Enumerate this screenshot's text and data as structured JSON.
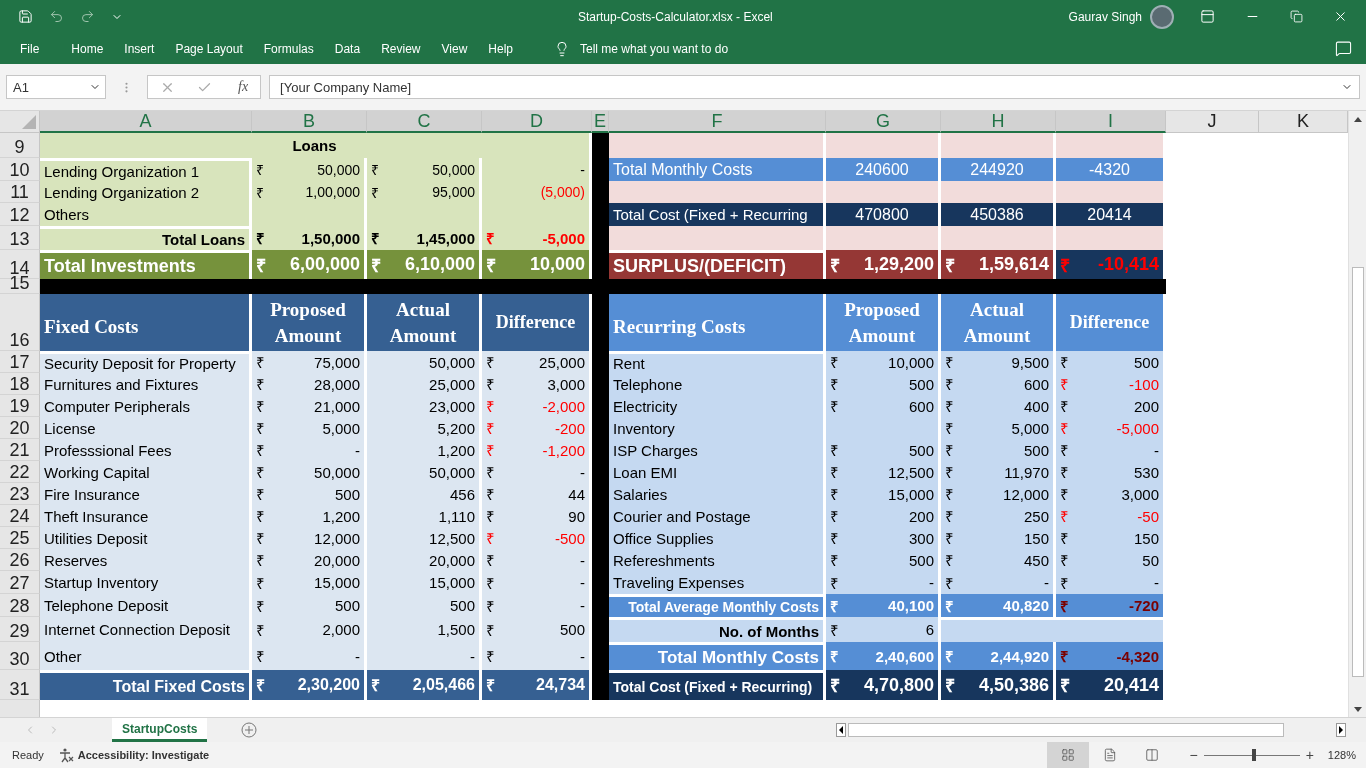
{
  "window": {
    "title": "Startup-Costs-Calculator.xlsx - Excel",
    "user": "Gaurav Singh"
  },
  "ribbon": {
    "tabs": [
      "File",
      "Home",
      "Insert",
      "Page Layout",
      "Formulas",
      "Data",
      "Review",
      "View",
      "Help"
    ],
    "tell_me": "Tell me what you want to do"
  },
  "formula_bar": {
    "name_box": "A1",
    "fx": "fx",
    "value": "[Your Company Name]"
  },
  "columns": [
    {
      "label": "A",
      "selected": true
    },
    {
      "label": "B",
      "selected": true
    },
    {
      "label": "C",
      "selected": true
    },
    {
      "label": "D",
      "selected": true
    },
    {
      "label": "E",
      "selected": true
    },
    {
      "label": "F",
      "selected": true
    },
    {
      "label": "G",
      "selected": true
    },
    {
      "label": "H",
      "selected": true
    },
    {
      "label": "I",
      "selected": true
    },
    {
      "label": "J",
      "selected": false
    },
    {
      "label": "K",
      "selected": false
    }
  ],
  "row_numbers": [
    "9",
    "10",
    "11",
    "12",
    "13",
    "14",
    "15",
    "16",
    "17",
    "18",
    "19",
    "20",
    "21",
    "22",
    "23",
    "24",
    "25",
    "26",
    "27",
    "28",
    "29",
    "30",
    "31"
  ],
  "loans": {
    "title": "Loans",
    "rows": [
      {
        "label": "Lending Organization 1",
        "proposed": {
          "symbol": "₹",
          "value": "50,000"
        },
        "actual": {
          "symbol": "₹",
          "value": "50,000"
        },
        "difference": {
          "value": "-",
          "negative": false
        }
      },
      {
        "label": "Lending Organization 2",
        "proposed": {
          "symbol": "₹",
          "value": "1,00,000"
        },
        "actual": {
          "symbol": "₹",
          "value": "95,000"
        },
        "difference": {
          "value": "(5,000)",
          "negative": true
        }
      },
      {
        "label": "Others",
        "proposed": {},
        "actual": {},
        "difference": {}
      }
    ],
    "total": {
      "label": "Total Loans",
      "proposed": {
        "symbol": "₹",
        "value": "1,50,000"
      },
      "actual": {
        "symbol": "₹",
        "value": "1,45,000"
      },
      "difference": {
        "symbol": "₹",
        "value": "-5,000",
        "negative": true
      }
    }
  },
  "total_investments": {
    "label": "Total Investments",
    "proposed": {
      "symbol": "₹",
      "value": "6,00,000"
    },
    "actual": {
      "symbol": "₹",
      "value": "6,10,000"
    },
    "difference": {
      "symbol": "₹",
      "value": "10,000",
      "negative": false
    }
  },
  "summary": {
    "rows": [
      {
        "kind": "blank"
      },
      {
        "kind": "monthly",
        "label": "Total Monthly Costs",
        "proposed": {
          "value": "240600"
        },
        "actual": {
          "value": "244920"
        },
        "difference": {
          "value": "-4320",
          "negative": false
        }
      },
      {
        "kind": "blank"
      },
      {
        "kind": "total",
        "label": "Total Cost (Fixed + Recurring",
        "proposed": {
          "value": "470800"
        },
        "actual": {
          "value": "450386"
        },
        "difference": {
          "value": "20414",
          "negative": false
        }
      },
      {
        "kind": "blank"
      }
    ],
    "surplus": {
      "label": "SURPLUS/(DEFICIT)",
      "proposed": {
        "symbol": "₹",
        "value": "1,29,200"
      },
      "actual": {
        "symbol": "₹",
        "value": "1,59,614"
      },
      "difference": {
        "symbol": "₹",
        "value": "-10,414",
        "negative": true
      }
    }
  },
  "fixed_costs": {
    "title": "Fixed Costs",
    "columns": [
      "Proposed Amount",
      "Actual Amount",
      "Difference"
    ],
    "rows": [
      {
        "label": "Security Deposit for Property",
        "proposed": {
          "symbol": "₹",
          "value": "75,000"
        },
        "actual": {
          "value": "50,000"
        },
        "difference": {
          "symbol": "₹",
          "value": "25,000",
          "negative": false
        }
      },
      {
        "label": "Furnitures and Fixtures",
        "proposed": {
          "symbol": "₹",
          "value": "28,000"
        },
        "actual": {
          "value": "25,000"
        },
        "difference": {
          "symbol": "₹",
          "value": "3,000",
          "negative": false
        }
      },
      {
        "label": "Computer Peripherals",
        "proposed": {
          "symbol": "₹",
          "value": "21,000"
        },
        "actual": {
          "value": "23,000"
        },
        "difference": {
          "symbol": "₹",
          "value": "-2,000",
          "negative": true
        }
      },
      {
        "label": "License",
        "proposed": {
          "symbol": "₹",
          "value": "5,000"
        },
        "actual": {
          "value": "5,200"
        },
        "difference": {
          "symbol": "₹",
          "value": "-200",
          "negative": true
        }
      },
      {
        "label": "Professsional Fees",
        "proposed": {
          "symbol": "₹",
          "value": "-"
        },
        "actual": {
          "value": "1,200"
        },
        "difference": {
          "symbol": "₹",
          "value": "-1,200",
          "negative": true
        }
      },
      {
        "label": "Working Capital",
        "proposed": {
          "symbol": "₹",
          "value": "50,000"
        },
        "actual": {
          "value": "50,000"
        },
        "difference": {
          "symbol": "₹",
          "value": "-",
          "negative": false
        }
      },
      {
        "label": "Fire Insurance",
        "proposed": {
          "symbol": "₹",
          "value": "500"
        },
        "actual": {
          "value": "456"
        },
        "difference": {
          "symbol": "₹",
          "value": "44",
          "negative": false
        }
      },
      {
        "label": "Theft Insurance",
        "proposed": {
          "symbol": "₹",
          "value": "1,200"
        },
        "actual": {
          "value": "1,110"
        },
        "difference": {
          "symbol": "₹",
          "value": "90",
          "negative": false
        }
      },
      {
        "label": "Utilities Deposit",
        "proposed": {
          "symbol": "₹",
          "value": "12,000"
        },
        "actual": {
          "value": "12,500"
        },
        "difference": {
          "symbol": "₹",
          "value": "-500",
          "negative": true
        }
      },
      {
        "label": "Reserves",
        "proposed": {
          "symbol": "₹",
          "value": "20,000"
        },
        "actual": {
          "value": "20,000"
        },
        "difference": {
          "symbol": "₹",
          "value": "-",
          "negative": false
        }
      },
      {
        "label": "Startup Inventory",
        "proposed": {
          "symbol": "₹",
          "value": "15,000"
        },
        "actual": {
          "value": "15,000"
        },
        "difference": {
          "symbol": "₹",
          "value": "-",
          "negative": false
        }
      },
      {
        "label": "Telephone Deposit",
        "proposed": {
          "symbol": "₹",
          "value": "500"
        },
        "actual": {
          "value": "500"
        },
        "difference": {
          "symbol": "₹",
          "value": "-",
          "negative": false
        }
      },
      {
        "label": "Internet Connection Deposit",
        "proposed": {
          "symbol": "₹",
          "value": "2,000"
        },
        "actual": {
          "value": "1,500"
        },
        "difference": {
          "symbol": "₹",
          "value": "500",
          "negative": false
        }
      },
      {
        "label": "Other",
        "proposed": {
          "symbol": "₹",
          "value": "-"
        },
        "actual": {
          "value": "-"
        },
        "difference": {
          "symbol": "₹",
          "value": "-",
          "negative": false
        }
      }
    ],
    "total": {
      "label": "Total Fixed Costs",
      "proposed": {
        "symbol": "₹",
        "value": "2,30,200"
      },
      "actual": {
        "symbol": "₹",
        "value": "2,05,466"
      },
      "difference": {
        "symbol": "₹",
        "value": "24,734",
        "negative": false
      }
    }
  },
  "recurring_costs": {
    "title": "Recurring Costs",
    "columns": [
      "Proposed Amount",
      "Actual Amount",
      "Difference"
    ],
    "rows": [
      {
        "label": "Rent",
        "proposed": {
          "symbol": "₹",
          "value": "10,000"
        },
        "actual": {
          "symbol": "₹",
          "value": "9,500"
        },
        "difference": {
          "symbol": "₹",
          "value": "500",
          "negative": false
        }
      },
      {
        "label": "Telephone",
        "proposed": {
          "symbol": "₹",
          "value": "500"
        },
        "actual": {
          "symbol": "₹",
          "value": "600"
        },
        "difference": {
          "symbol": "₹",
          "value": "-100",
          "negative": true
        }
      },
      {
        "label": "Electricity",
        "proposed": {
          "symbol": "₹",
          "value": "600"
        },
        "actual": {
          "symbol": "₹",
          "value": "400"
        },
        "difference": {
          "symbol": "₹",
          "value": "200",
          "negative": false
        }
      },
      {
        "label": "Inventory",
        "proposed": {},
        "actual": {
          "symbol": "₹",
          "value": "5,000"
        },
        "difference": {
          "symbol": "₹",
          "value": "-5,000",
          "negative": true
        }
      },
      {
        "label": "ISP Charges",
        "proposed": {
          "symbol": "₹",
          "value": "500"
        },
        "actual": {
          "symbol": "₹",
          "value": "500"
        },
        "difference": {
          "symbol": "₹",
          "value": "-",
          "negative": false
        }
      },
      {
        "label": "Loan EMI",
        "proposed": {
          "symbol": "₹",
          "value": "12,500"
        },
        "actual": {
          "symbol": "₹",
          "value": "11,970"
        },
        "difference": {
          "symbol": "₹",
          "value": "530",
          "negative": false
        }
      },
      {
        "label": "Salaries",
        "proposed": {
          "symbol": "₹",
          "value": "15,000"
        },
        "actual": {
          "symbol": "₹",
          "value": "12,000"
        },
        "difference": {
          "symbol": "₹",
          "value": "3,000",
          "negative": false
        }
      },
      {
        "label": "Courier and Postage",
        "proposed": {
          "symbol": "₹",
          "value": "200"
        },
        "actual": {
          "symbol": "₹",
          "value": "250"
        },
        "difference": {
          "symbol": "₹",
          "value": "-50",
          "negative": true
        }
      },
      {
        "label": "Office Supplies",
        "proposed": {
          "symbol": "₹",
          "value": "300"
        },
        "actual": {
          "symbol": "₹",
          "value": "150"
        },
        "difference": {
          "symbol": "₹",
          "value": "150",
          "negative": false
        }
      },
      {
        "label": "Refereshments",
        "proposed": {
          "symbol": "₹",
          "value": "500"
        },
        "actual": {
          "symbol": "₹",
          "value": "450"
        },
        "difference": {
          "symbol": "₹",
          "value": "50",
          "negative": false
        }
      },
      {
        "label": "Traveling Expenses",
        "proposed": {
          "symbol": "₹",
          "value": "-"
        },
        "actual": {
          "symbol": "₹",
          "value": "-"
        },
        "difference": {
          "symbol": "₹",
          "value": "-",
          "negative": false
        }
      }
    ],
    "average": {
      "label": "Total Average Monthly Costs",
      "proposed": {
        "symbol": "₹",
        "value": "40,100"
      },
      "actual": {
        "symbol": "₹",
        "value": "40,820"
      },
      "difference": {
        "symbol": "₹",
        "value": "-720",
        "negative": true
      }
    },
    "months": {
      "label": "No. of Months",
      "proposed": {
        "symbol": "₹",
        "value": "6"
      }
    },
    "monthly_total": {
      "label": "Total Monthly Costs",
      "proposed": {
        "symbol": "₹",
        "value": "2,40,600"
      },
      "actual": {
        "symbol": "₹",
        "value": "2,44,920"
      },
      "difference": {
        "symbol": "₹",
        "value": "-4,320",
        "negative": true
      }
    },
    "grand_total": {
      "label": "Total Cost (Fixed + Recurring)",
      "proposed": {
        "symbol": "₹",
        "value": "4,70,800"
      },
      "actual": {
        "symbol": "₹",
        "value": "4,50,386"
      },
      "difference": {
        "symbol": "₹",
        "value": "20,414",
        "negative": false
      }
    }
  },
  "sheet_tabs": [
    {
      "label": "StartupCosts",
      "selected": true
    }
  ],
  "status_bar": {
    "status": "Ready",
    "accessibility": "Accessibility: Investigate",
    "views": [
      {
        "kind": "normal",
        "selected": true
      },
      {
        "kind": "page_layout",
        "selected": false
      },
      {
        "kind": "page_break",
        "selected": false
      }
    ],
    "zoom": {
      "minus": "−",
      "plus": "+",
      "level": 0.52,
      "reading": "128%"
    }
  }
}
